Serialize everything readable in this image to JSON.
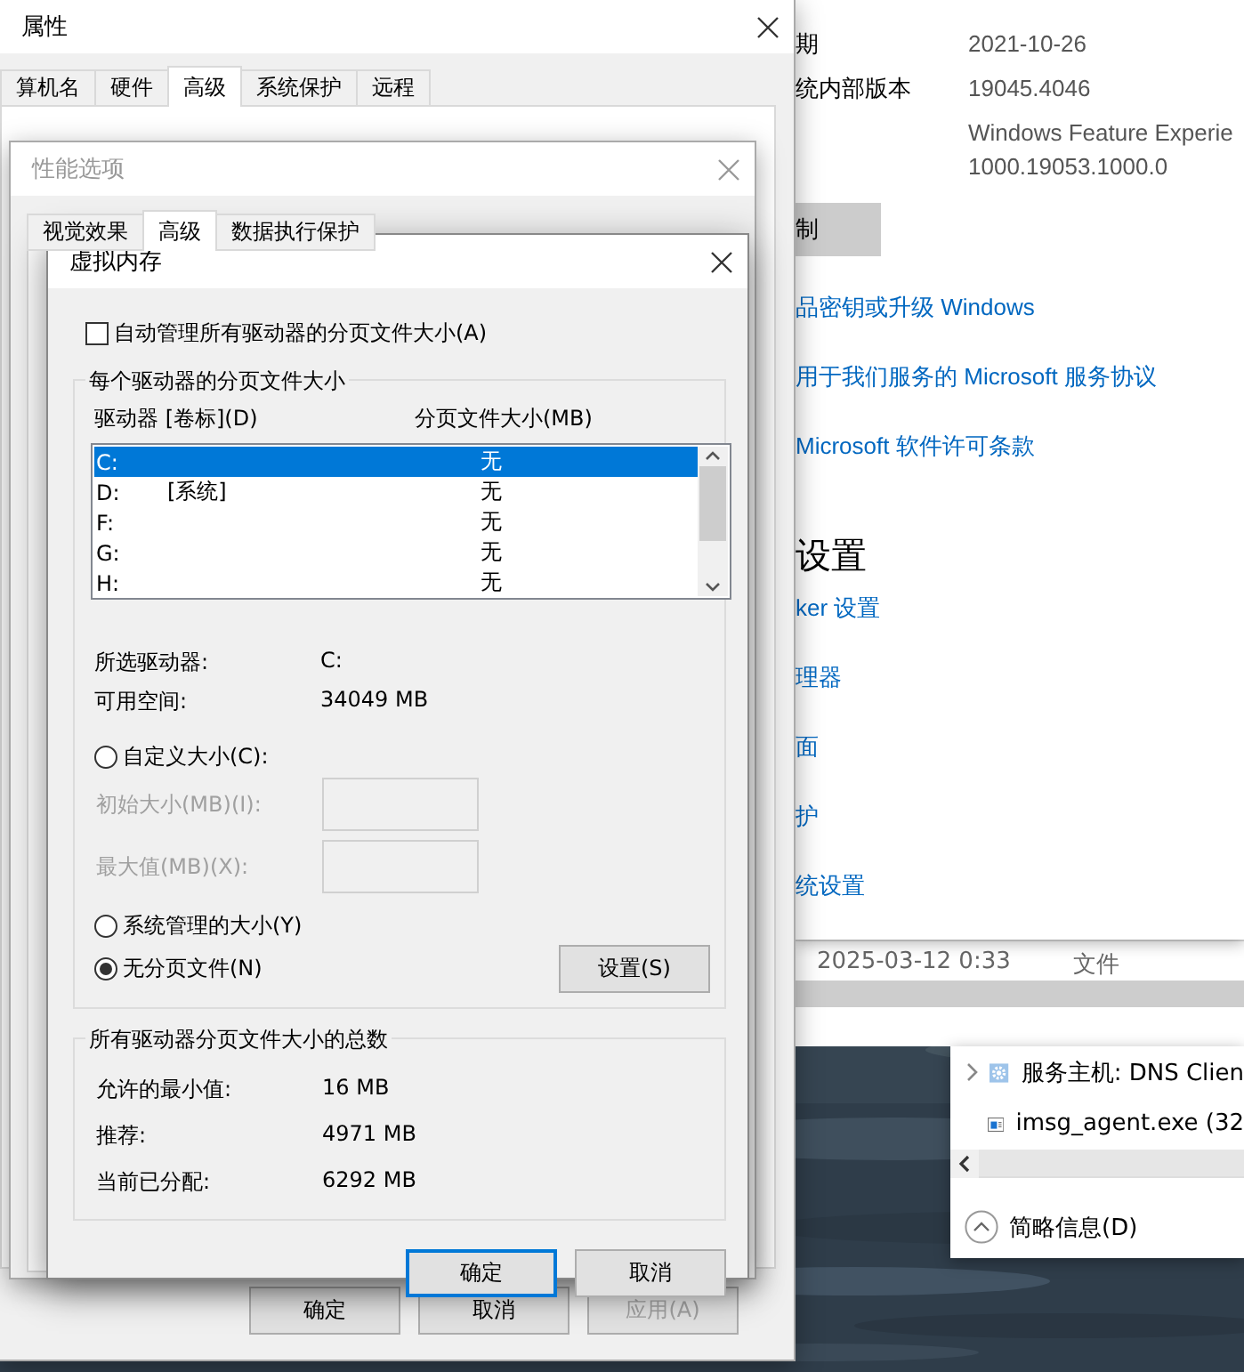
{
  "system_properties": {
    "title": "属性",
    "tabs": [
      {
        "label": "算机名",
        "selected": false
      },
      {
        "label": "硬件",
        "selected": false
      },
      {
        "label": "高级",
        "selected": true
      },
      {
        "label": "系统保护",
        "selected": false
      },
      {
        "label": "远程",
        "selected": false
      }
    ],
    "buttons": [
      {
        "label": "确定",
        "disabled": false
      },
      {
        "label": "取消",
        "disabled": false
      },
      {
        "label": "应用(A)",
        "disabled": true
      }
    ]
  },
  "performance_options": {
    "title": "性能选项",
    "tabs": [
      {
        "label": "视觉效果",
        "selected": false
      },
      {
        "label": "高级",
        "selected": true
      },
      {
        "label": "数据执行保护",
        "selected": false
      }
    ]
  },
  "virtual_memory": {
    "title": "虚拟内存",
    "auto_manage": {
      "label": "自动管理所有驱动器的分页文件大小(A)",
      "checked": false
    },
    "per_drive": {
      "title": "每个驱动器的分页文件大小",
      "columns": [
        "驱动器 [卷标](D)",
        "分页文件大小(MB)"
      ],
      "rows": [
        {
          "drive": "C:",
          "label": "",
          "size": "无",
          "selected": true
        },
        {
          "drive": "D:",
          "label": "[系统]",
          "size": "无",
          "selected": false
        },
        {
          "drive": "F:",
          "label": "",
          "size": "无",
          "selected": false
        },
        {
          "drive": "G:",
          "label": "",
          "size": "无",
          "selected": false
        },
        {
          "drive": "H:",
          "label": "",
          "size": "无",
          "selected": false
        }
      ],
      "info": [
        {
          "label": "所选驱动器:",
          "value": "C:"
        },
        {
          "label": "可用空间:",
          "value": "34049 MB"
        }
      ],
      "options": [
        {
          "label": "自定义大小(C):",
          "selected": false
        },
        {
          "label": "系统管理的大小(Y)",
          "selected": false
        },
        {
          "label": "无分页文件(N)",
          "selected": true
        }
      ],
      "fields": [
        {
          "label": "初始大小(MB)(I):",
          "disabled": true
        },
        {
          "label": "最大值(MB)(X):",
          "disabled": true
        }
      ],
      "set_button": "设置(S)"
    },
    "totals": {
      "title": "所有驱动器分页文件大小的总数",
      "rows": [
        {
          "label": "允许的最小值:",
          "value": "16 MB"
        },
        {
          "label": "推荐:",
          "value": "4971 MB"
        },
        {
          "label": "当前已分配:",
          "value": "6292 MB"
        }
      ]
    },
    "buttons": [
      {
        "label": "确定",
        "default": true
      },
      {
        "label": "取消",
        "default": false
      }
    ]
  },
  "about": {
    "specs": [
      {
        "label": "期",
        "lines": [
          "2021-10-26"
        ]
      },
      {
        "label": "统内部版本",
        "lines": [
          "19045.4046"
        ]
      },
      {
        "lines": [
          "Windows Feature Experie",
          "1000.19053.1000.0"
        ]
      }
    ],
    "copy_button": "制",
    "links": [
      "品密钥或升级 Windows",
      "用于我们服务的 Microsoft 服务协议",
      "Microsoft 软件许可条款"
    ],
    "heading": "设置",
    "related": [
      "ker 设置",
      "理器",
      "面",
      "护",
      "统设置"
    ]
  },
  "explorer": {
    "date": "2025-03-12 0:33",
    "type": "文件"
  },
  "task_manager": {
    "rows": [
      {
        "kind": "service",
        "name": "服务主机: DNS Clien",
        "expandable": true
      },
      {
        "kind": "app",
        "name": "imsg_agent.exe (32",
        "expandable": false
      }
    ],
    "footer": "简略信息(D)"
  }
}
